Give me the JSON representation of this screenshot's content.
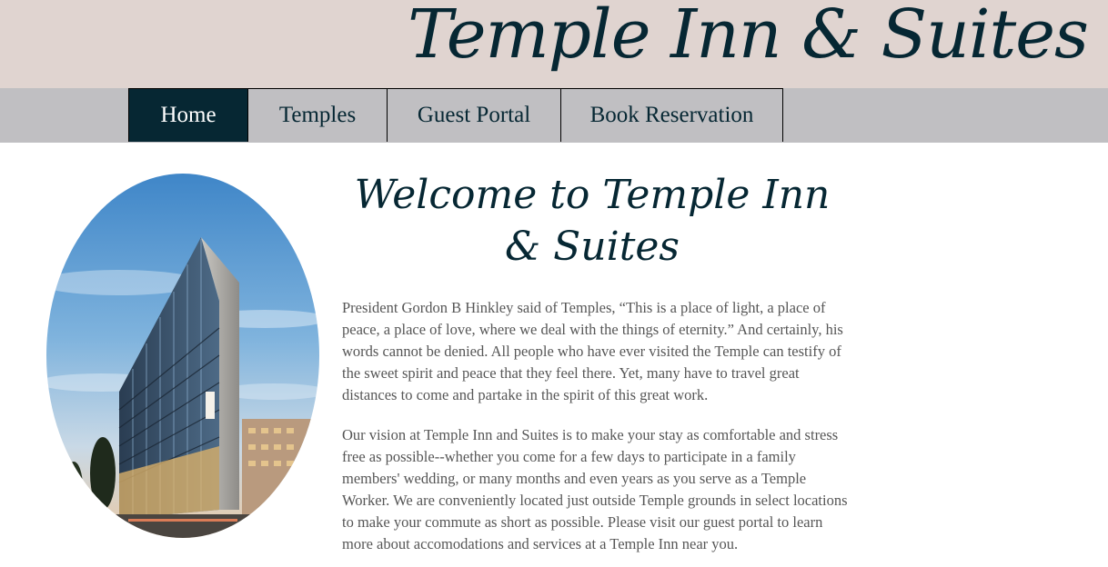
{
  "header": {
    "logo_text": "Temple Inn & Suites"
  },
  "nav": {
    "items": [
      "Home",
      "Temples",
      "Guest Portal",
      "Book Reservation"
    ]
  },
  "main": {
    "title": "Welcome to Temple Inn & Suites",
    "paragraphs": [
      "President Gordon B Hinkley said of Temples, “This is a place of light, a place of peace, a place of love, where we deal with the things of eternity.” And certainly, his words cannot be denied. All people who have ever visited the Temple can testify of the sweet spirit and peace that they feel there. Yet, many have to travel great distances to come and partake in the spirit of this great work.",
      "Our vision at Temple Inn and Suites is to make your stay as comfortable and stress free as possible--whether you come for a few days to participate in a family members' wedding, or many months and even years as you serve as a Temple Worker. We are conveniently located just outside Temple grounds in select locations to make your commute as short as possible. Please visit our guest portal to learn more about accomodations and services at a Temple Inn near you."
    ]
  },
  "colors": {
    "brand": "#062733",
    "header_bg": "#e0d4d0",
    "nav_bg": "#c0bfc2",
    "body_text": "#565656"
  }
}
